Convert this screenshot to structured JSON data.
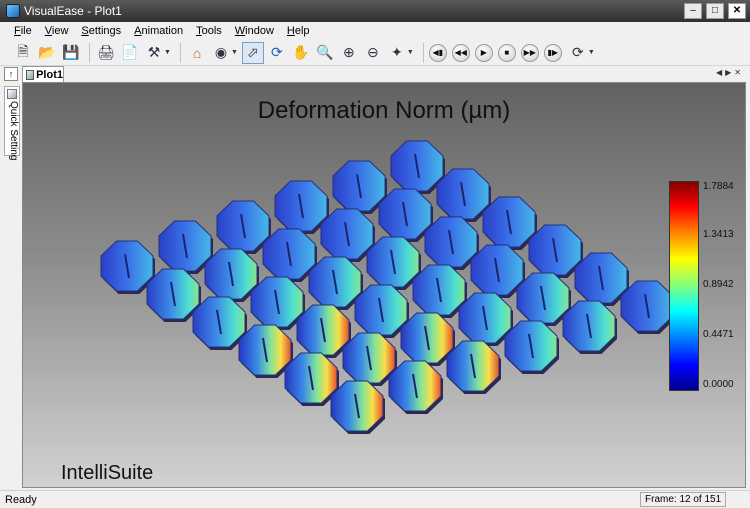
{
  "window": {
    "title": "VisualEase - Plot1"
  },
  "menu": [
    "File",
    "View",
    "Settings",
    "Animation",
    "Tools",
    "Window",
    "Help"
  ],
  "toolbar": {
    "icons": [
      "new-icon",
      "open-icon",
      "save-icon",
      "print-icon",
      "print-preview-icon",
      "settings-tools-icon",
      "home-icon",
      "binoculars-icon",
      "select-arrow-icon",
      "rotate-icon",
      "pan-hand-icon",
      "zoom-icon",
      "zoom-in-icon",
      "zoom-out-icon",
      "pick-icon",
      "first-frame-icon",
      "rewind-icon",
      "play-icon",
      "stop-icon",
      "fast-forward-icon",
      "last-frame-icon",
      "loop-icon"
    ]
  },
  "tab": {
    "label": "Plot1"
  },
  "side_panel": {
    "label": "Quick Setting"
  },
  "plot": {
    "title": "Deformation Norm (µm)",
    "brand": "IntelliSuite",
    "colorbar": {
      "labels": [
        "1.7884",
        "1.3413",
        "0.8942",
        "0.4471",
        "0.0000"
      ]
    }
  },
  "status": {
    "left": "Ready",
    "frame": "Frame: 12 of 151"
  }
}
